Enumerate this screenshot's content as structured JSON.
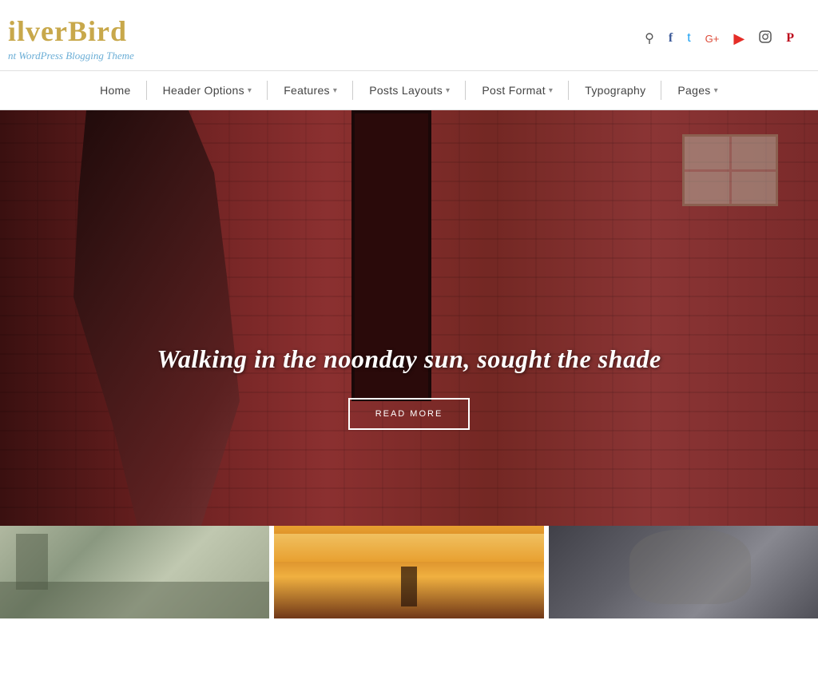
{
  "site": {
    "logo_title": "ilverBird",
    "logo_subtitle": "nt WordPress Blogging Theme"
  },
  "social_icons": [
    {
      "name": "search",
      "symbol": "🔍",
      "class": "icon-search"
    },
    {
      "name": "facebook",
      "symbol": "f",
      "class": "icon-facebook"
    },
    {
      "name": "twitter",
      "symbol": "𝕥",
      "class": "icon-twitter"
    },
    {
      "name": "googleplus",
      "symbol": "G+",
      "class": "icon-googleplus"
    },
    {
      "name": "youtube",
      "symbol": "▶",
      "class": "icon-youtube"
    },
    {
      "name": "instagram",
      "symbol": "📷",
      "class": "icon-instagram"
    },
    {
      "name": "pinterest",
      "symbol": "P",
      "class": "icon-pinterest"
    }
  ],
  "nav": {
    "items": [
      {
        "label": "Home",
        "has_arrow": false
      },
      {
        "label": "Header Options",
        "has_arrow": true
      },
      {
        "label": "Features",
        "has_arrow": true
      },
      {
        "label": "Posts Layouts",
        "has_arrow": true
      },
      {
        "label": "Post Format",
        "has_arrow": true
      },
      {
        "label": "Typography",
        "has_arrow": false
      },
      {
        "label": "Pages",
        "has_arrow": true
      }
    ]
  },
  "hero": {
    "title": "Walking in the noonday sun, sought the shade",
    "button_label": "READ MORE"
  },
  "cards": [
    {
      "id": "card-1",
      "class": "card-1"
    },
    {
      "id": "card-2",
      "class": "card-2"
    },
    {
      "id": "card-3",
      "class": "card-3"
    }
  ]
}
